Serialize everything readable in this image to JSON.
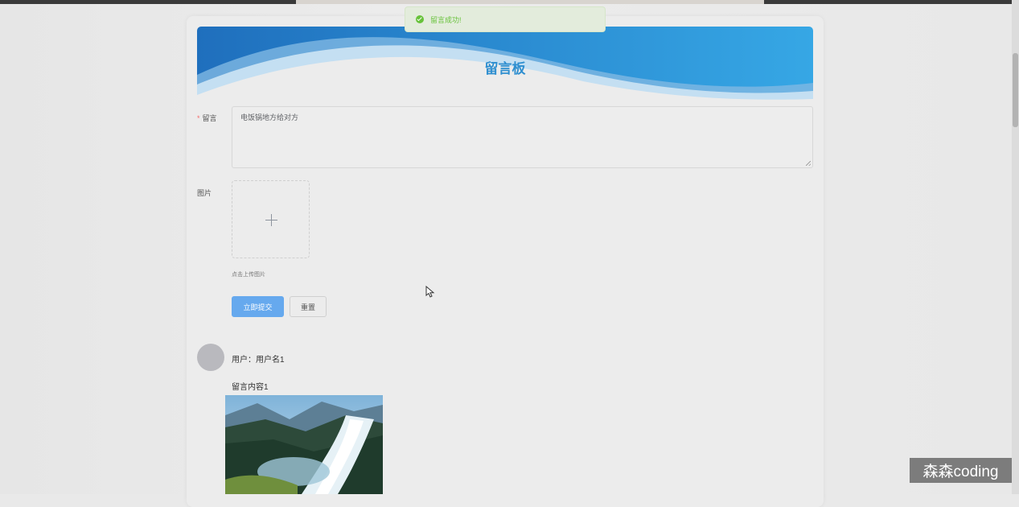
{
  "toast": {
    "icon": "check-circle-icon",
    "text": "留言成功!",
    "color": "#67c23a"
  },
  "banner": {
    "title": "留言板",
    "title_color": "#2f8fd0"
  },
  "form": {
    "message_label": "留言",
    "required_mark": "*",
    "message_value": "电饭锅地方给对方",
    "image_label": "图片",
    "upload_icon": "plus-icon",
    "upload_hint": "点击上传图片",
    "submit_label": "立即提交",
    "reset_label": "重置",
    "primary_color": "#66a9ee"
  },
  "messages": [
    {
      "user_line": "用户：用户名1",
      "content": "留言内容1",
      "image": "waterfall-photo"
    }
  ],
  "watermark": "森森coding"
}
